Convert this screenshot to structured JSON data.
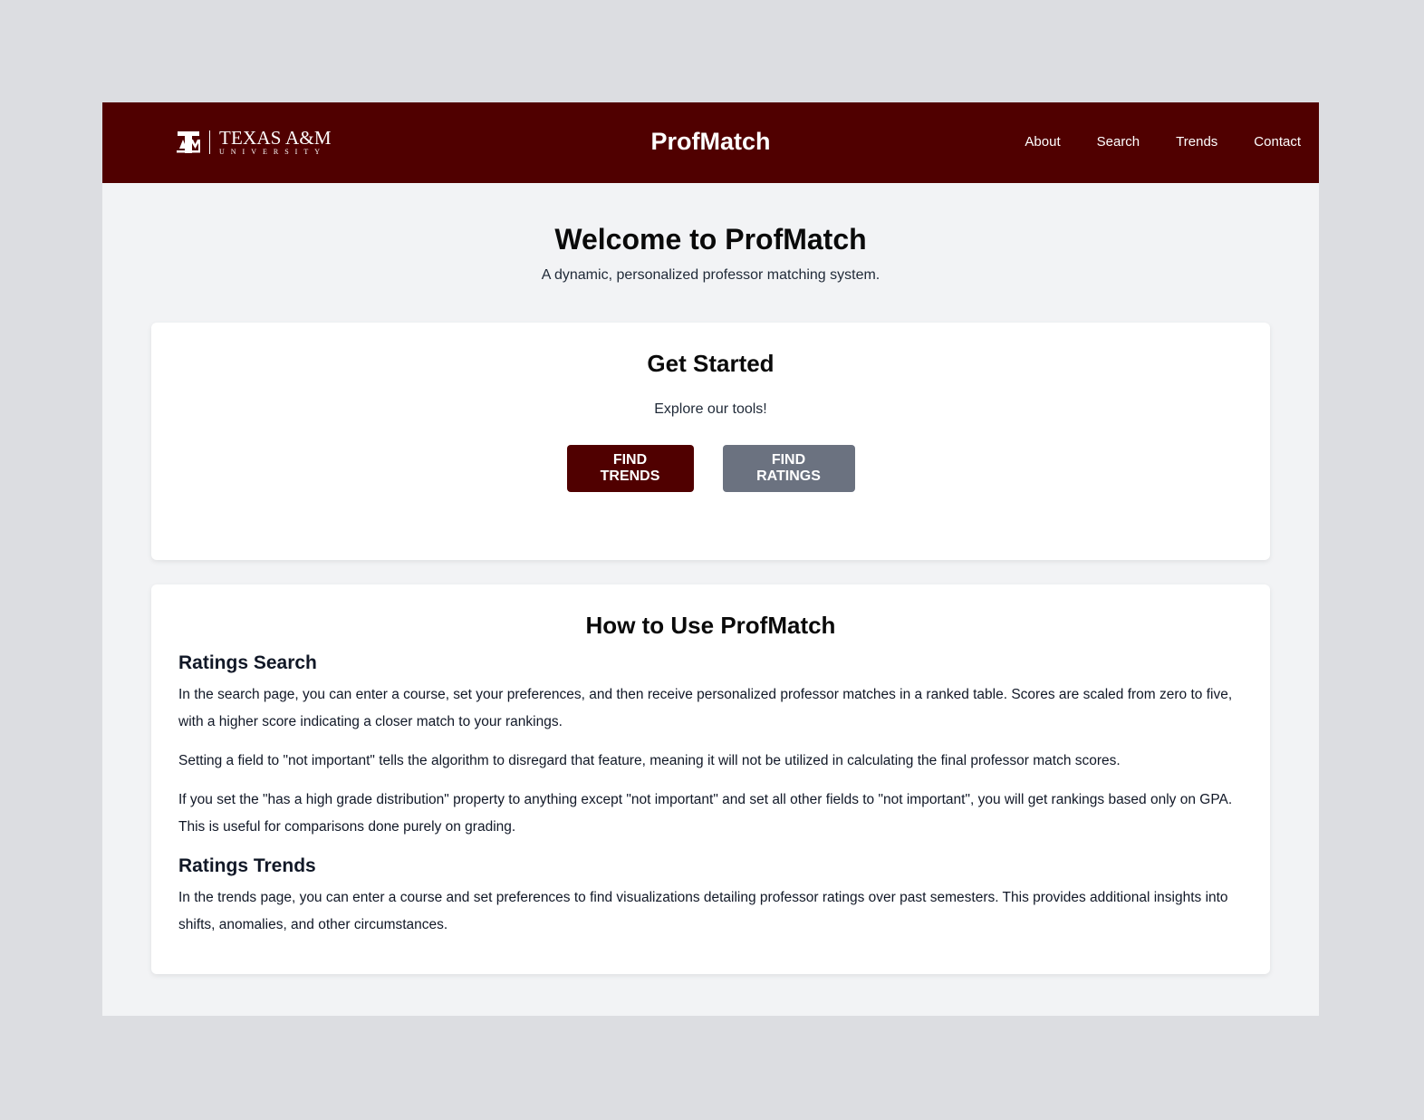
{
  "navbar": {
    "logo": {
      "icon": "texas-am-logo-icon",
      "main_text": "TEXAS A&M",
      "sub_text": "UNIVERSITY"
    },
    "brand": "ProfMatch",
    "links": [
      "About",
      "Search",
      "Trends",
      "Contact"
    ],
    "background_color": "#500000"
  },
  "hero": {
    "title": "Welcome to ProfMatch",
    "subtitle": "A dynamic, personalized professor matching system."
  },
  "get_started": {
    "title": "Get Started",
    "subtitle": "Explore our tools!",
    "find_trends_label": "FIND TRENDS",
    "find_ratings_label": "FIND RATINGS",
    "primary_color": "#500000",
    "secondary_color": "#6b7280"
  },
  "how_to": {
    "title": "How to Use ProfMatch",
    "sections": [
      {
        "heading": "Ratings Search",
        "paragraphs": [
          "In the search page, you can enter a course, set your preferences, and then receive personalized professor matches in a ranked table. Scores are scaled from zero to five, with a higher score indicating a closer match to your rankings.",
          "Setting a field to \"not important\" tells the algorithm to disregard that feature, meaning it will not be utilized in calculating the final professor match scores.",
          "If you set the \"has a high grade distribution\" property to anything except \"not important\" and set all other fields to \"not important\", you will get rankings based only on GPA. This is useful for comparisons done purely on grading."
        ]
      },
      {
        "heading": "Ratings Trends",
        "paragraphs": [
          "In the trends page, you can enter a course and set preferences to find visualizations detailing professor ratings over past semesters. This provides additional insights into shifts, anomalies, and other circumstances."
        ]
      }
    ]
  }
}
